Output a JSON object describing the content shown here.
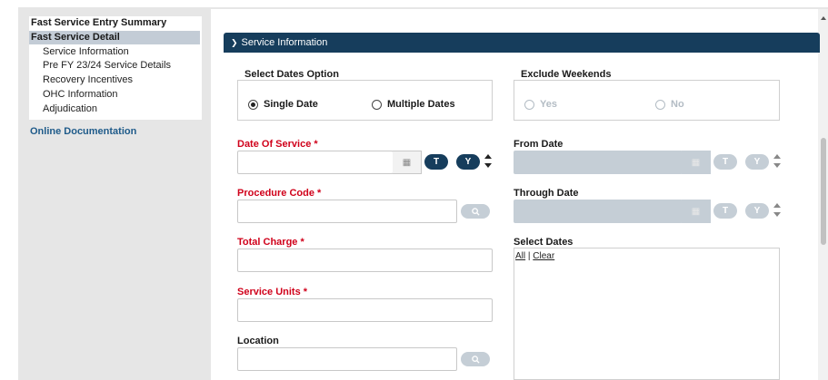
{
  "nav": {
    "items": [
      {
        "label": "Fast Service Entry Summary",
        "level": "head",
        "active": false
      },
      {
        "label": "Fast Service Detail",
        "level": "head",
        "active": true
      },
      {
        "label": "Service Information",
        "level": "sub",
        "active": false
      },
      {
        "label": "Pre FY 23/24 Service Details",
        "level": "sub",
        "active": false
      },
      {
        "label": "Recovery Incentives",
        "level": "sub",
        "active": false
      },
      {
        "label": "OHC Information",
        "level": "sub",
        "active": false
      },
      {
        "label": "Adjudication",
        "level": "sub",
        "active": false
      }
    ],
    "doc_link": "Online Documentation"
  },
  "section": {
    "title": "Service Information"
  },
  "dates_option": {
    "label": "Select Dates Option",
    "single": "Single Date",
    "multiple": "Multiple Dates",
    "selected": "single"
  },
  "exclude_weekends": {
    "label": "Exclude Weekends",
    "yes": "Yes",
    "no": "No"
  },
  "fields": {
    "date_of_service": {
      "label": "Date Of Service",
      "required_mark": "*",
      "value": ""
    },
    "procedure_code": {
      "label": "Procedure Code",
      "required_mark": "*",
      "value": ""
    },
    "total_charge": {
      "label": "Total Charge",
      "required_mark": "*",
      "value": ""
    },
    "service_units": {
      "label": "Service Units",
      "required_mark": "*",
      "value": ""
    },
    "location": {
      "label": "Location",
      "value": ""
    },
    "from_date": {
      "label": "From Date",
      "value": ""
    },
    "through_date": {
      "label": "Through Date",
      "value": ""
    },
    "select_dates": {
      "label": "Select Dates",
      "all": "All",
      "separator": "|",
      "clear": "Clear"
    }
  },
  "buttons": {
    "today": "T",
    "yesterday": "Y"
  },
  "colors": {
    "header_bg": "#163d5c",
    "required": "#d0021b",
    "disabled": "#c5ced6",
    "link": "#1f5b8a"
  }
}
